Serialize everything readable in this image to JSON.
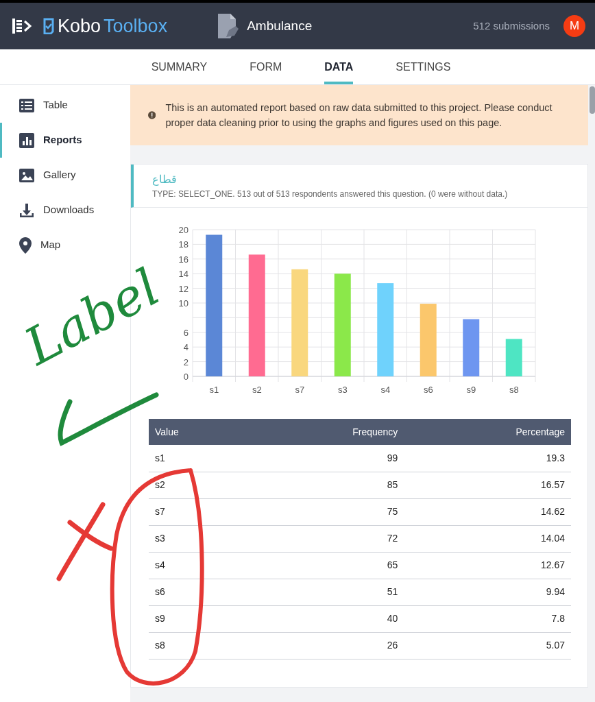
{
  "header": {
    "logo": {
      "brand_a": "Kobo",
      "brand_b": "Toolbox"
    },
    "project": "Ambulance",
    "submissions": "512 submissions",
    "avatar": "M"
  },
  "tabs": [
    {
      "label": "SUMMARY",
      "selected": false
    },
    {
      "label": "FORM",
      "selected": false
    },
    {
      "label": "DATA",
      "selected": true
    },
    {
      "label": "SETTINGS",
      "selected": false
    }
  ],
  "sidebar": {
    "items": [
      {
        "label": "Table",
        "selected": false
      },
      {
        "label": "Reports",
        "selected": true
      },
      {
        "label": "Gallery",
        "selected": false
      },
      {
        "label": "Downloads",
        "selected": false
      },
      {
        "label": "Map",
        "selected": false
      }
    ]
  },
  "notice": "This is an automated report based on raw data submitted to this project. Please conduct proper data cleaning prior to using the graphs and figures used on this page.",
  "question": {
    "title": "قطاع",
    "meta": "TYPE: SELECT_ONE. 513 out of 513 respondents answered this question. (0 were without data.)",
    "chart_data": {
      "type": "bar",
      "categories": [
        "s1",
        "s2",
        "s7",
        "s3",
        "s4",
        "s6",
        "s9",
        "s8"
      ],
      "values": [
        19.3,
        16.6,
        14.6,
        14.0,
        12.7,
        9.9,
        7.8,
        5.1
      ],
      "grid": true,
      "colors": [
        "#5b87d6",
        "#ff6b91",
        "#f9d77e",
        "#8be84a",
        "#6fd2fc",
        "#fbc76c",
        "#6e96f0",
        "#4ee5c3"
      ],
      "ylim": [
        0,
        20
      ],
      "yticks": [
        0,
        2,
        4,
        6,
        10,
        12,
        14,
        16,
        18,
        20
      ]
    },
    "table": {
      "columns": [
        "Value",
        "Frequency",
        "Percentage"
      ],
      "rows": [
        [
          "s1",
          "99",
          "19.3"
        ],
        [
          "s2",
          "85",
          "16.57"
        ],
        [
          "s7",
          "75",
          "14.62"
        ],
        [
          "s3",
          "72",
          "14.04"
        ],
        [
          "s4",
          "65",
          "12.67"
        ],
        [
          "s6",
          "51",
          "9.94"
        ],
        [
          "s9",
          "40",
          "7.8"
        ],
        [
          "s8",
          "26",
          "5.07"
        ]
      ]
    }
  },
  "annotations": [
    {
      "kind": "text",
      "text": "Label",
      "color": "#1f8a3c"
    },
    {
      "kind": "check",
      "color": "#1f8a3c"
    },
    {
      "kind": "cross",
      "color": "#e53935"
    },
    {
      "kind": "oval",
      "color": "#e53935"
    }
  ]
}
